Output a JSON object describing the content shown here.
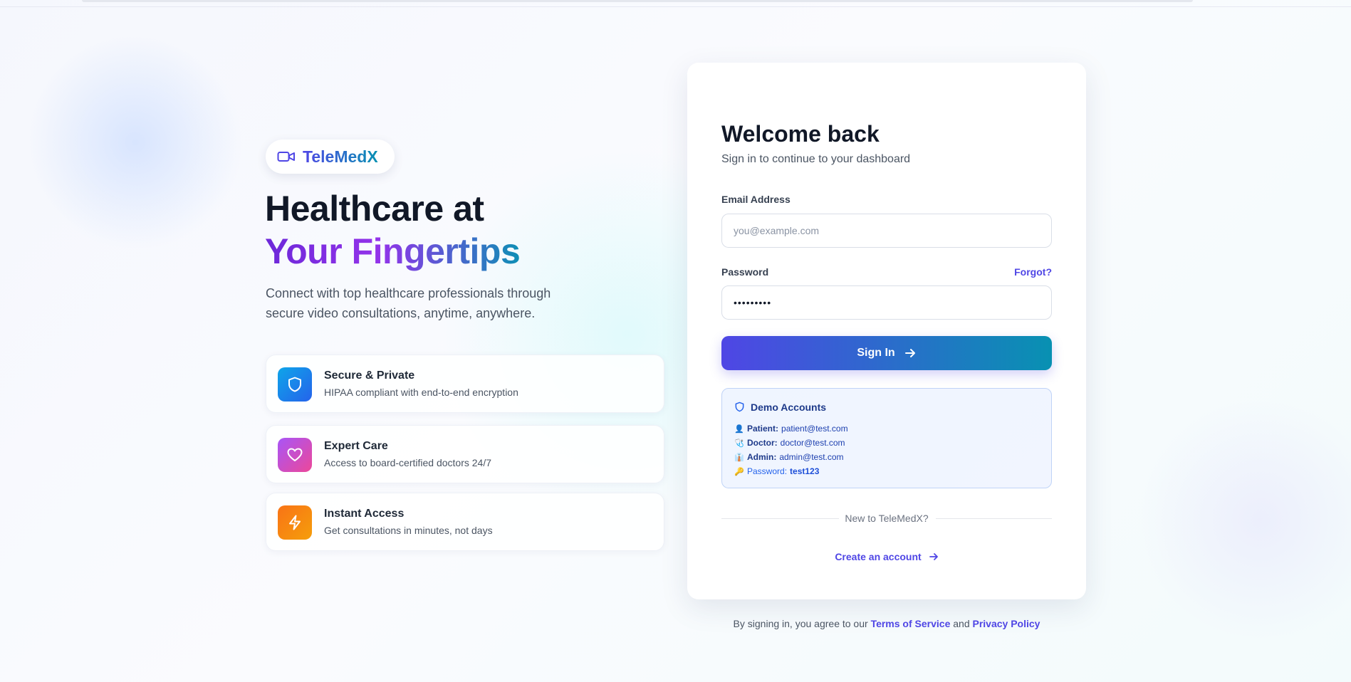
{
  "brand": {
    "name": "TeleMedX",
    "icon": "video-camera-icon"
  },
  "hero": {
    "line1": "Healthcare at",
    "line2": "Your Fingertips",
    "subtitle": "Connect with top healthcare professionals through secure video consultations, anytime, anywhere."
  },
  "features": [
    {
      "title": "Secure & Private",
      "desc": "HIPAA compliant with end-to-end encryption",
      "icon": "shield-icon",
      "color": "#0ea5e9"
    },
    {
      "title": "Expert Care",
      "desc": "Access to board-certified doctors 24/7",
      "icon": "heart-icon",
      "color": "#c026d3"
    },
    {
      "title": "Instant Access",
      "desc": "Get consultations in minutes, not days",
      "icon": "lightning-icon",
      "color": "#f97316"
    }
  ],
  "login": {
    "title": "Welcome back",
    "subtitle": "Sign in to continue to your dashboard",
    "email_label": "Email Address",
    "email_placeholder": "you@example.com",
    "email_value": "",
    "password_label": "Password",
    "password_value": "password1",
    "forgot_label": "Forgot?",
    "signin_label": "Sign In"
  },
  "demo": {
    "title": "Demo Accounts",
    "accounts": [
      {
        "emoji": "👤",
        "role": "Patient:",
        "email": "patient@test.com"
      },
      {
        "emoji": "🩺",
        "role": "Doctor:",
        "email": "doctor@test.com"
      },
      {
        "emoji": "👔",
        "role": "Admin:",
        "email": "admin@test.com"
      }
    ],
    "password_emoji": "🔑",
    "password_label": "Password:",
    "password_value": "test123"
  },
  "signup": {
    "divider_text": "New to TeleMedX?",
    "create_label": "Create an account"
  },
  "legal": {
    "prefix": "By signing in, you agree to our",
    "terms": "Terms of Service",
    "and": "and",
    "privacy": "Privacy Policy"
  },
  "colors": {
    "primary": "#4f46e5",
    "secondary": "#0891b2",
    "text_dark": "#111827"
  }
}
